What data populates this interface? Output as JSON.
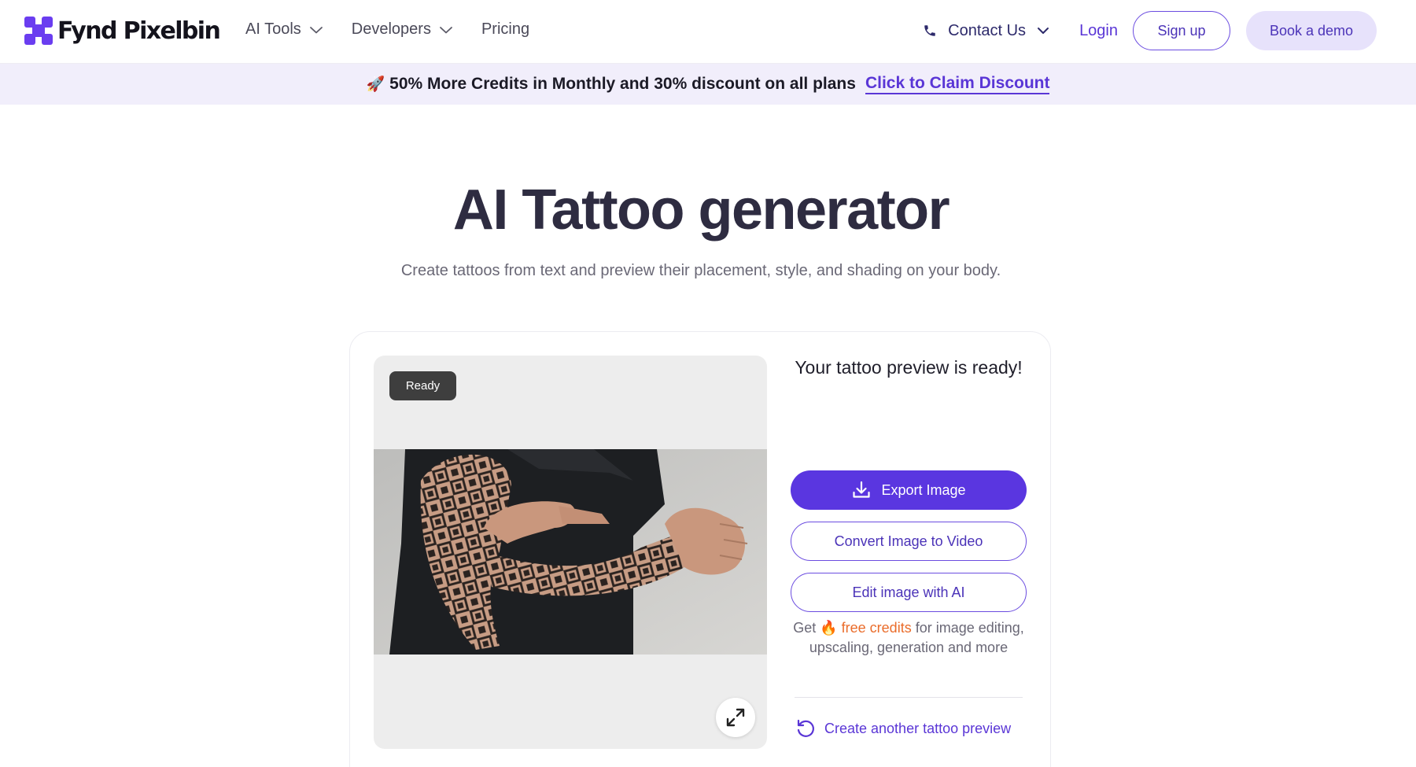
{
  "brand": {
    "name": "Fynd Pixelbin",
    "colors": {
      "primary": "#5a36e0",
      "accent_orange": "#ea6c2a",
      "banner_bg": "#f1eefb"
    }
  },
  "nav": {
    "items": [
      {
        "label": "AI Tools",
        "icon": "chevron-down-icon"
      },
      {
        "label": "Developers",
        "icon": "chevron-down-icon"
      },
      {
        "label": "Pricing"
      }
    ]
  },
  "header_right": {
    "contact_label": "Contact Us",
    "login_label": "Login",
    "signup_label": "Sign up",
    "demo_label": "Book a demo"
  },
  "banner": {
    "emoji": "🚀",
    "text": "50% More Credits in Monthly and 30% discount on all plans",
    "link_label": "Click to Claim Discount"
  },
  "hero": {
    "title": "AI Tattoo generator",
    "subtitle": "Create tattoos from text and preview their placement, style, and shading on your body."
  },
  "preview": {
    "badge": "Ready"
  },
  "result_panel": {
    "title": "Your tattoo preview is ready!",
    "export_label": "Export Image",
    "video_label": "Convert Image to Video",
    "edit_label": "Edit image with AI",
    "credits_prefix": "Get",
    "credits_emoji": "🔥",
    "credits_highlight": "free credits",
    "credits_suffix": "for image editing, upscaling, generation and more",
    "another_label": "Create another tattoo preview"
  }
}
